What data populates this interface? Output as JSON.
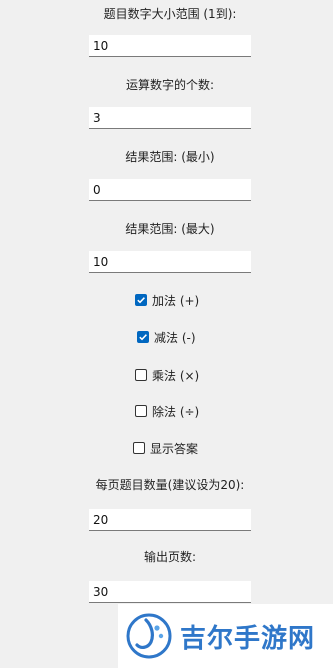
{
  "form": {
    "range_label": "题目数字大小范围 (1到):",
    "range_value": "10",
    "count_label": "运算数字的个数:",
    "count_value": "3",
    "min_label": "结果范围: (最小)",
    "min_value": "0",
    "max_label": "结果范围: (最大)",
    "max_value": "10",
    "per_page_label": "每页题目数量(建议设为20):",
    "per_page_value": "20",
    "pages_label": "输出页数:",
    "pages_value": "30"
  },
  "options": [
    {
      "label": "加法 (+)",
      "checked": true
    },
    {
      "label": "减法 (-)",
      "checked": true
    },
    {
      "label": "乘法 (×)",
      "checked": false
    },
    {
      "label": "除法 (÷)",
      "checked": false
    },
    {
      "label": "显示答案",
      "checked": false
    }
  ],
  "watermark": {
    "text": "吉尔手游网",
    "color": "#2f77c9"
  },
  "colors": {
    "check_accent": "#0067c0",
    "background": "#f0f0f0"
  }
}
